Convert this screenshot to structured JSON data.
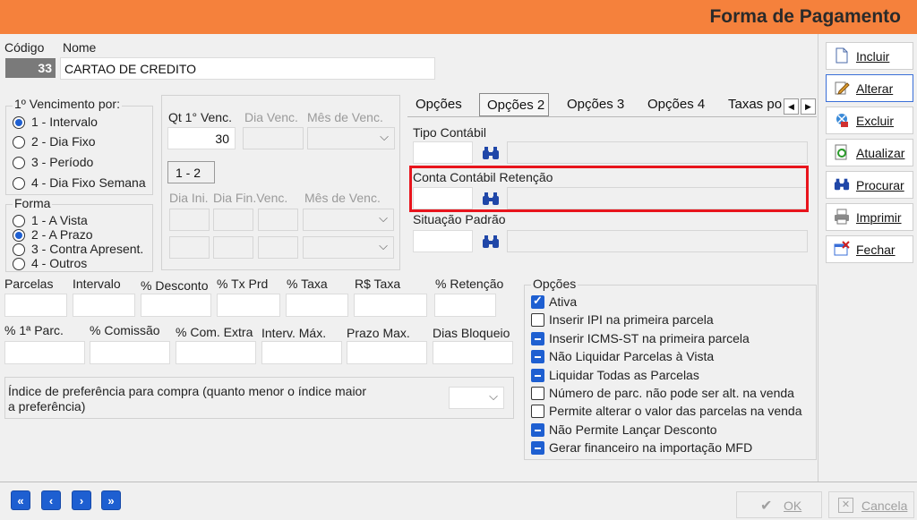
{
  "title": "Forma de Pagamento",
  "header": {
    "codigo_label": "Código",
    "nome_label": "Nome",
    "codigo_value": "33",
    "nome_value": "CARTAO DE CREDITO"
  },
  "vencimento": {
    "label": "1º Vencimento por:",
    "options": [
      "1 - Intervalo",
      "2 - Dia Fixo",
      "3 - Período",
      "4 - Dia Fixo Semana"
    ],
    "selected": "1 - Intervalo"
  },
  "forma": {
    "label": "Forma",
    "options": [
      "1 - A Vista",
      "2 - A Prazo",
      "3 - Contra Apresent.",
      "4 - Outros"
    ],
    "selected": "2 - A Prazo"
  },
  "qt": {
    "qt_label": "Qt 1° Venc.",
    "qt_value": "30",
    "dia_venc_label": "Dia Venc.",
    "mes_venc_label": "Mês de Venc.",
    "range_label": "1 - 2",
    "dia_ini_label": "Dia Ini.",
    "dia_fin_label": "Dia Fin.Venc.",
    "mes_venc2_label": "Mês de Venc."
  },
  "tabs": [
    "Opções",
    "Opções 2",
    "Opções 3",
    "Opções 4",
    "Taxas po"
  ],
  "active_tab": "Opções 2",
  "contabil": {
    "tipo_label": "Tipo Contábil",
    "retencao_label": "Conta Contábil Retenção",
    "situacao_label": "Situação Padrão"
  },
  "fields_row1": [
    "Parcelas",
    "Intervalo",
    "% Desconto",
    "% Tx Prd",
    "% Taxa",
    "R$ Taxa",
    "% Retenção"
  ],
  "fields_row2": [
    "% 1ª Parc.",
    "% Comissão",
    "% Com. Extra",
    "Interv. Máx.",
    "Prazo Max.",
    "Dias Bloqueio"
  ],
  "indice": {
    "line1": "Índice de preferência para compra (quanto menor o índice maior",
    "line2": "a preferência)"
  },
  "opcoes": {
    "label": "Opções",
    "items": [
      {
        "label": "Ativa",
        "state": "checked"
      },
      {
        "label": "Inserir IPI na primeira parcela",
        "state": "unchecked"
      },
      {
        "label": "Inserir ICMS-ST na primeira parcela",
        "state": "indeterminate"
      },
      {
        "label": "Não Liquidar Parcelas à Vista",
        "state": "indeterminate"
      },
      {
        "label": "Liquidar Todas as Parcelas",
        "state": "indeterminate"
      },
      {
        "label": "Número de parc. não pode ser alt. na venda",
        "state": "unchecked"
      },
      {
        "label": "Permite alterar o valor das parcelas na venda",
        "state": "unchecked"
      },
      {
        "label": "Não Permite Lançar Desconto",
        "state": "indeterminate"
      },
      {
        "label": "Gerar financeiro na importação MFD",
        "state": "indeterminate"
      }
    ]
  },
  "actions": [
    "Incluir",
    "Alterar",
    "Excluir",
    "Atualizar",
    "Procurar",
    "Imprimir",
    "Fechar"
  ],
  "footer": {
    "ok_label": "OK",
    "cancel_label": "Cancela"
  },
  "nav_icons": [
    "first-icon",
    "prev-icon",
    "next-icon",
    "last-icon"
  ],
  "colors": {
    "titlebar": "#f5813c",
    "accent": "#1e5fd1",
    "highlight": "#e8141c"
  }
}
